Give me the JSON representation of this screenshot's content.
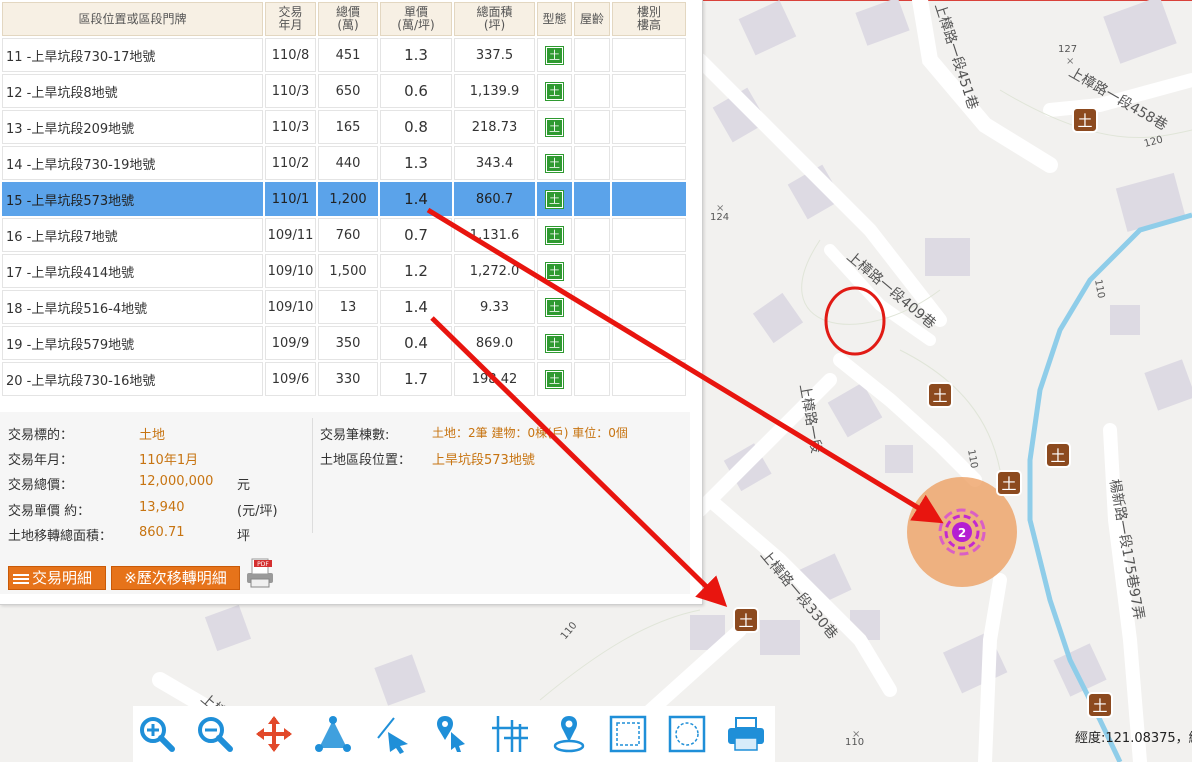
{
  "table": {
    "headers": [
      {
        "l1": "區段位置或區段門牌",
        "l2": ""
      },
      {
        "l1": "交易",
        "l2": "年月"
      },
      {
        "l1": "總價",
        "l2": "(萬)"
      },
      {
        "l1": "單價",
        "l2": "(萬/坪)"
      },
      {
        "l1": "總面積",
        "l2": "(坪)"
      },
      {
        "l1": "型態",
        "l2": ""
      },
      {
        "l1": "屋齡",
        "l2": ""
      },
      {
        "l1": "樓別",
        "l2": "樓高"
      }
    ],
    "rows": [
      {
        "loc": "11 -上旱坑段730-17地號",
        "date": "110/8",
        "total": "451",
        "unit": "1.3",
        "area": "337.5",
        "type": "土",
        "age": "",
        "floor": ""
      },
      {
        "loc": "12 -上旱坑段8地號",
        "date": "110/3",
        "total": "650",
        "unit": "0.6",
        "area": "1,139.9",
        "type": "土",
        "age": "",
        "floor": ""
      },
      {
        "loc": "13 -上旱坑段209地號",
        "date": "110/3",
        "total": "165",
        "unit": "0.8",
        "area": "218.73",
        "type": "土",
        "age": "",
        "floor": ""
      },
      {
        "loc": "14 -上旱坑段730-19地號",
        "date": "110/2",
        "total": "440",
        "unit": "1.3",
        "area": "343.4",
        "type": "土",
        "age": "",
        "floor": ""
      },
      {
        "loc": "15 -上旱坑段573地號",
        "date": "110/1",
        "total": "1,200",
        "unit": "1.4",
        "area": "860.7",
        "type": "土",
        "age": "",
        "floor": "",
        "selected": true
      },
      {
        "loc": "16 -上旱坑段7地號",
        "date": "109/11",
        "total": "760",
        "unit": "0.7",
        "area": "1,131.6",
        "type": "土",
        "age": "",
        "floor": ""
      },
      {
        "loc": "17 -上旱坑段414地號",
        "date": "109/10",
        "total": "1,500",
        "unit": "1.2",
        "area": "1,272.0",
        "type": "土",
        "age": "",
        "floor": ""
      },
      {
        "loc": "18 -上旱坑段516-4地號",
        "date": "109/10",
        "total": "13",
        "unit": "1.4",
        "area": "9.33",
        "type": "土",
        "age": "",
        "floor": ""
      },
      {
        "loc": "19 -上旱坑段579地號",
        "date": "109/9",
        "total": "350",
        "unit": "0.4",
        "area": "869.0",
        "type": "土",
        "age": "",
        "floor": ""
      },
      {
        "loc": "20 -上旱坑段730-16地號",
        "date": "109/6",
        "total": "330",
        "unit": "1.7",
        "area": "198.42",
        "type": "土",
        "age": "",
        "floor": ""
      }
    ]
  },
  "detail": {
    "target_label": "交易標的：",
    "target_value": "土地",
    "date_label": "交易年月：",
    "date_value": "110年1月",
    "total_label": "交易總價：",
    "total_value": "12,000,000",
    "total_unit": "元",
    "unit_label": "交易單價 約：",
    "unit_value": "13,940",
    "unit_unit": "(元/坪)",
    "area_label": "土地移轉總面積：",
    "area_value": "860.71",
    "area_unit": "坪",
    "count_label": "交易筆棟數:",
    "count_value": "土地：2筆 建物：0棟(戶) 車位：0個",
    "section_label": "土地區段位置：",
    "section_value": "上旱坑段573地號"
  },
  "buttons": {
    "detail": "交易明細",
    "history": "※歷次移轉明細",
    "print_pdf": "PDF"
  },
  "map": {
    "roads": [
      {
        "label": "上樟路一段451巷"
      },
      {
        "label": "上樟路一段458巷"
      },
      {
        "label": "上樟路一段409巷"
      },
      {
        "label": "上樟路一段"
      },
      {
        "label": "上樟路一段330巷"
      },
      {
        "label": "楊新路一段175巷97弄"
      },
      {
        "label": "上樟"
      }
    ],
    "elevations": [
      "127",
      "120",
      "124",
      "110",
      "110",
      "110",
      "110"
    ],
    "land_marker": "土",
    "cluster_count": "2"
  },
  "toolbar": {
    "icons": [
      "zoom-in-icon",
      "zoom-out-icon",
      "pan-icon",
      "measure-area-icon",
      "measure-distance-icon",
      "locate-click-icon",
      "coordinate-grid-icon",
      "gps-locate-icon",
      "select-area-icon",
      "clear-area-icon",
      "print-icon"
    ]
  },
  "status": {
    "coord": "經度:121.08375，緯"
  },
  "colors": {
    "selected_row": "#5ba3ea",
    "header_bg": "#f7f0e4",
    "value_text": "#c77411",
    "button": "#e6731a",
    "land_icon": "#2f9a31",
    "marker": "#8c4a1f",
    "cluster": "#ec9b5b",
    "cluster_center": "#b51fd2",
    "arrow": "#e8150f",
    "river": "#8fcde9"
  }
}
